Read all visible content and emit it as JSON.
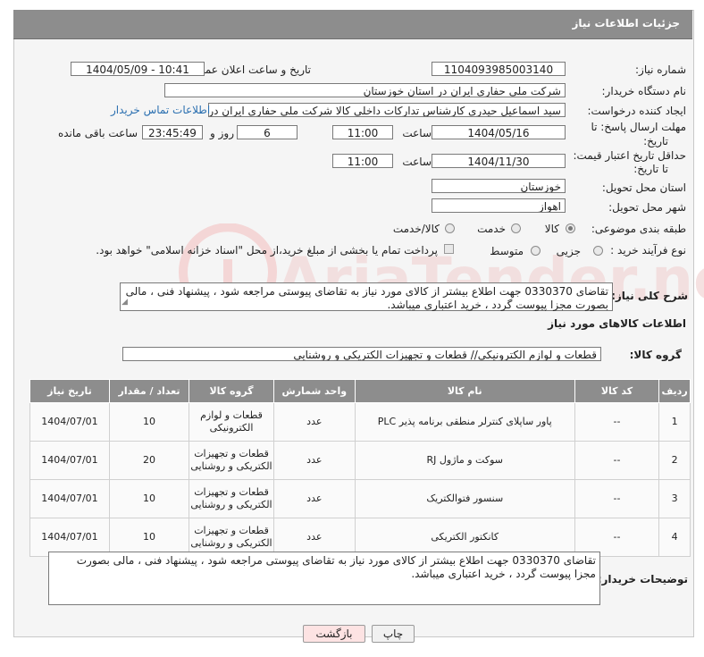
{
  "header": {
    "title": "جزئیات اطلاعات نیاز"
  },
  "fields": {
    "need_number_label": "شماره نیاز:",
    "need_number": "1104093985003140",
    "announce_label": "تاریخ و ساعت اعلان عمومی:",
    "announce_value": "1404/05/09 - 10:41",
    "buyer_label": "نام دستگاه خریدار:",
    "buyer_value": "شرکت ملی حفاری ایران در استان خوزستان",
    "creator_label": "ایجاد کننده درخواست:",
    "creator_value": "سید اسماعیل حیدری کارشناس تدارکات داخلی کالا شرکت ملی حفاری ایران در",
    "contact_link": "اطلاعات تماس خریدار",
    "deadline_label_1": "مهلت ارسال پاسخ: تا",
    "deadline_label_2": "تاریخ:",
    "deadline_date": "1404/05/16",
    "time_label": "ساعت",
    "deadline_time": "11:00",
    "days_value": "6",
    "days_label": "روز و",
    "remaining_value": "23:45:49",
    "remaining_label": "ساعت باقی مانده",
    "price_label_1": "حداقل تاریخ اعتبار قیمت:",
    "price_label_2": "تا تاریخ:",
    "price_date": "1404/11/30",
    "price_time": "11:00",
    "province_label": "استان محل تحویل:",
    "province_value": "خوزستان",
    "city_label": "شهر محل تحویل:",
    "city_value": "اهواز",
    "category_label": "طبقه بندی موضوعی:",
    "category_options": [
      "کالا",
      "خدمت",
      "کالا/خدمت"
    ],
    "purchase_label": "نوع فرآیند خرید :",
    "purchase_options": [
      "جزیی",
      "متوسط"
    ],
    "payment_note": "پرداخت تمام یا بخشی از مبلغ خرید،از محل \"اسناد خزانه اسلامی\" خواهد بود.",
    "summary_label": "شرح کلی نیاز:",
    "summary_text": "تقاضای 0330370 جهت اطلاع بیشتر از کالای مورد نیاز به تقاضای پیوستی مراجعه شود ، پیشنهاد فنی ، مالی بصورت مجزا پیوست گردد ، خرید اعتباری میباشد.",
    "goods_info_title": "اطلاعات کالاهای مورد نیاز",
    "goods_group_label": "گروه کالا:",
    "goods_group_value": "قطعات و لوازم الکترونیکی// قطعات و تجهیزات الکتریکی و روشنایی",
    "buyer_notes_label": "توضیحات خریدار:",
    "buyer_notes_text": "تقاضای 0330370 جهت اطلاع بیشتر از کالای مورد نیاز به تقاضای پیوستی مراجعه شود ، پیشنهاد فنی ، مالی بصورت مجزا پیوست گردد ، خرید اعتباری میباشد."
  },
  "table": {
    "headers": [
      "ردیف",
      "کد کالا",
      "نام کالا",
      "واحد شمارش",
      "گروه کالا",
      "تعداد / مقدار",
      "تاریخ نیاز"
    ],
    "rows": [
      [
        "1",
        "--",
        "پاور ساپلای کنترلر منطقی برنامه پذیر PLC",
        "عدد",
        "قطعات و لوازم الکترونیکی",
        "10",
        "1404/07/01"
      ],
      [
        "2",
        "--",
        "سوکت و ماژول RJ",
        "عدد",
        "قطعات و تجهیزات الکتریکی و روشنایی",
        "20",
        "1404/07/01"
      ],
      [
        "3",
        "--",
        "سنسور فتوالکتریک",
        "عدد",
        "قطعات و تجهیزات الکتریکی و روشنایی",
        "10",
        "1404/07/01"
      ],
      [
        "4",
        "--",
        "کانکتور الکتریکی",
        "عدد",
        "قطعات و تجهیزات الکتریکی و روشنایی",
        "10",
        "1404/07/01"
      ]
    ]
  },
  "buttons": {
    "print": "چاپ",
    "back": "بازگشت"
  },
  "colors": {
    "header_bg": "#8d8d8d",
    "back_button_bg": "#fde3e3",
    "link": "#2a6fb0"
  }
}
